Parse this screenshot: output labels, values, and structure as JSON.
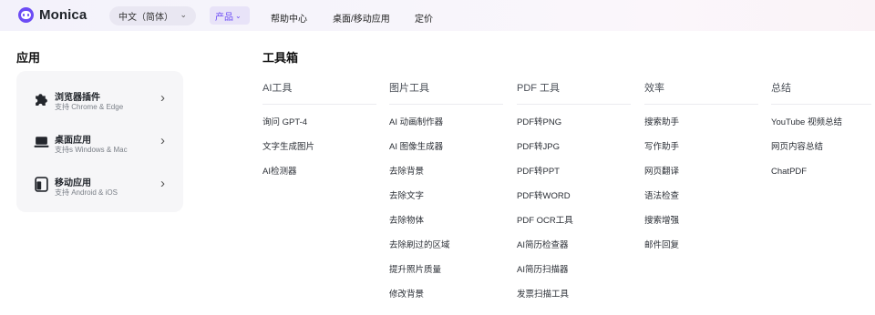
{
  "nav": {
    "brand": "Monica",
    "language": "中文（简体）",
    "products": "产品",
    "help": "帮助中心",
    "desktop_mobile": "桌面/移动应用",
    "pricing": "定价"
  },
  "apps": {
    "title": "应用",
    "items": [
      {
        "name": "浏览器插件",
        "sub": "支持 Chrome & Edge",
        "icon": "puzzle-icon"
      },
      {
        "name": "桌面应用",
        "sub": "支持s Windows & Mac",
        "icon": "laptop-icon"
      },
      {
        "name": "移动应用",
        "sub": "支持 Android & iOS",
        "icon": "mobile-icon"
      }
    ]
  },
  "toolbox": {
    "title": "工具箱",
    "columns": [
      {
        "header": "AI工具",
        "items": [
          "询问 GPT-4",
          "文字生成图片",
          "AI检测器"
        ]
      },
      {
        "header": "图片工具",
        "items": [
          "AI 动画制作器",
          "AI 图像生成器",
          "去除背景",
          "去除文字",
          "去除物体",
          "去除刷过的区域",
          "提升照片质量",
          "修改背景"
        ]
      },
      {
        "header": "PDF 工具",
        "items": [
          "PDF转PNG",
          "PDF转JPG",
          "PDF转PPT",
          "PDF转WORD",
          "PDF OCR工具",
          "AI简历检查器",
          "AI简历扫描器",
          "发票扫描工具"
        ]
      },
      {
        "header": "效率",
        "items": [
          "搜索助手",
          "写作助手",
          "网页翻译",
          "语法检查",
          "搜索增强",
          "邮件回复"
        ]
      },
      {
        "header": "总结",
        "items": [
          "YouTube 视频总结",
          "网页内容总结",
          "ChatPDF"
        ]
      }
    ]
  }
}
